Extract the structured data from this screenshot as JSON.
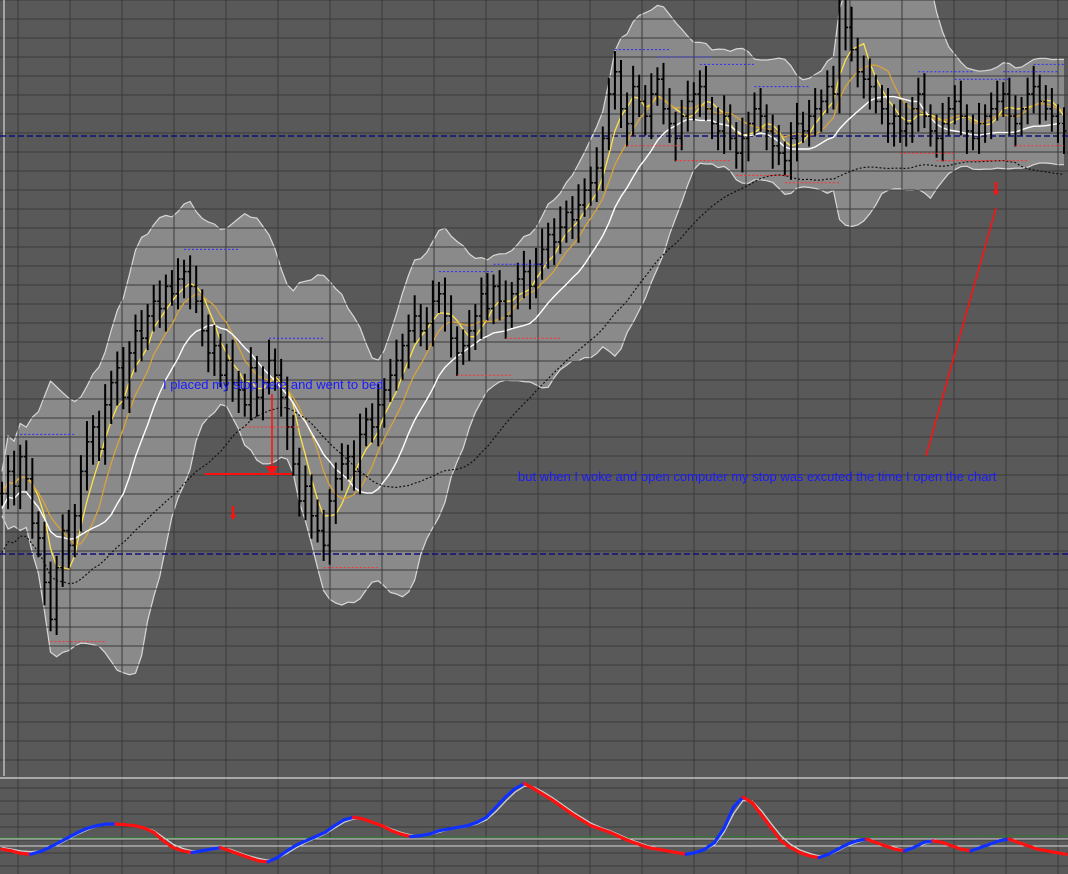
{
  "chart_data": [
    {
      "type": "candlestick",
      "panel": "price",
      "x": {
        "count": 176
      },
      "ylim": [
        0,
        100
      ],
      "grid": true,
      "series": [
        {
          "values": [
            36,
            39,
            37,
            41,
            38,
            32,
            30,
            24,
            19,
            26,
            31,
            29,
            33,
            39,
            43,
            45,
            42,
            48,
            51,
            53,
            49,
            55,
            58,
            57,
            60,
            62,
            61,
            64,
            63,
            65,
            66,
            64,
            62,
            58,
            55,
            56,
            52,
            54,
            51,
            50,
            48,
            53,
            49,
            51,
            54,
            52,
            49,
            45,
            40,
            35,
            37,
            33,
            31,
            29,
            35,
            38,
            40,
            41,
            39,
            44,
            46,
            45,
            48,
            50,
            52,
            54,
            56,
            58,
            60,
            58,
            59,
            62,
            63,
            60,
            57,
            55,
            56,
            58,
            60,
            63,
            61,
            64,
            62,
            60,
            63,
            65,
            66,
            64,
            67,
            69,
            71,
            70,
            72,
            74,
            73,
            75,
            77,
            78,
            80,
            84,
            90,
            93,
            88,
            86,
            91,
            89,
            87,
            90,
            92,
            88,
            86,
            84,
            87,
            89,
            90,
            91,
            88,
            86,
            85,
            87,
            84,
            82,
            84,
            86,
            88,
            87,
            85,
            83,
            82,
            81,
            84,
            86,
            85,
            87,
            88,
            89,
            91,
            90,
            104,
            99,
            96,
            93,
            92,
            91,
            89,
            88,
            86,
            87,
            85,
            86,
            88,
            90,
            87,
            85,
            84,
            86,
            88,
            89,
            87,
            85,
            84,
            86,
            87,
            88,
            89,
            90,
            87,
            86,
            88,
            90,
            91,
            89,
            88,
            87,
            86,
            85
          ]
        }
      ]
    },
    {
      "type": "line",
      "panel": "oscillator",
      "ylim": [
        0,
        100
      ],
      "series": [
        {
          "name": "",
          "values": [
            20,
            18,
            15,
            14,
            17,
            22,
            28,
            34,
            40,
            45,
            48,
            50,
            50,
            49,
            48,
            45,
            40,
            30,
            22,
            18,
            16,
            18,
            20,
            22,
            18,
            14,
            10,
            6,
            5,
            10,
            18,
            25,
            30,
            35,
            40,
            48,
            55,
            58,
            56,
            52,
            48,
            42,
            38,
            35,
            36,
            38,
            42,
            44,
            46,
            48,
            52,
            58,
            70,
            82,
            92,
            98,
            92,
            85,
            78,
            70,
            62,
            55,
            48,
            44,
            40,
            35,
            30,
            26,
            22,
            20,
            18,
            16,
            14,
            16,
            20,
            28,
            45,
            70,
            82,
            75,
            60,
            45,
            30,
            22,
            16,
            12,
            10,
            14,
            20,
            26,
            30,
            32,
            28,
            24,
            20,
            18,
            22,
            28,
            30,
            28,
            24,
            20,
            18,
            22,
            26,
            30,
            32,
            28,
            24,
            20,
            18,
            16,
            14
          ]
        },
        {
          "name": "",
          "values": [
            22,
            20,
            18,
            17,
            18,
            21,
            26,
            32,
            38,
            43,
            47,
            49,
            50,
            49,
            48,
            46,
            42,
            34,
            26,
            21,
            18,
            18,
            19,
            21,
            20,
            16,
            12,
            9,
            7,
            9,
            15,
            22,
            28,
            33,
            38,
            45,
            52,
            56,
            56,
            53,
            49,
            44,
            40,
            37,
            36,
            37,
            40,
            43,
            45,
            47,
            50,
            55,
            65,
            77,
            88,
            95,
            94,
            88,
            81,
            73,
            65,
            58,
            51,
            46,
            42,
            37,
            32,
            28,
            24,
            21,
            19,
            17,
            15,
            16,
            19,
            25,
            40,
            62,
            78,
            77,
            65,
            50,
            36,
            26,
            19,
            15,
            12,
            13,
            18,
            24,
            28,
            31,
            29,
            25,
            22,
            19,
            21,
            26,
            29,
            28,
            25,
            21,
            19,
            21,
            25,
            29,
            31,
            29,
            25,
            21,
            19,
            17,
            15
          ]
        }
      ]
    }
  ],
  "annotations": {
    "stop_note": "I placed my stop here and went to bed",
    "woke_note": "but when I woke and open computer my stop was excuted the time I open the chart"
  },
  "colors": {
    "background": "#595959",
    "band_fill": "#8a8a8a",
    "grid": "#3a3a3a",
    "bars": "#000000",
    "ma_yellow": "#ffe24a",
    "ma_orange": "#d8a33a",
    "ma_white": "#ffffff",
    "dashed_blue": "#10107a",
    "arrow_red": "#ff1010",
    "osc_fast_blue": "#1030ff",
    "osc_fast_red": "#ff1010",
    "osc_slow": "#d0d0d0"
  }
}
